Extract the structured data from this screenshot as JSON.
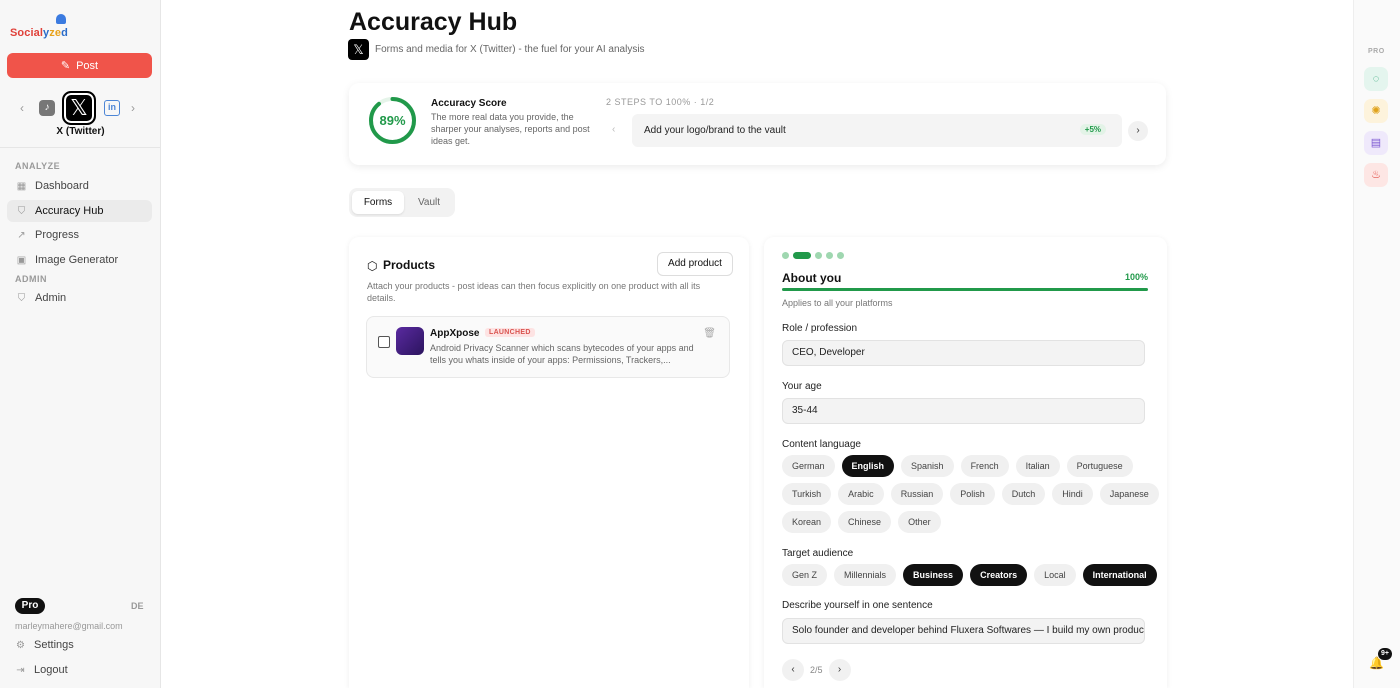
{
  "brand": {
    "part1": "Social",
    "part2": "y",
    "part3": "ze",
    "part4": "d"
  },
  "sidebar": {
    "post_label": "Post",
    "platform_label": "X (Twitter)",
    "section_analyze": "ANALYZE",
    "section_admin": "ADMIN",
    "items": [
      {
        "label": "Dashboard",
        "icon": "grid-icon"
      },
      {
        "label": "Accuracy Hub",
        "icon": "shield-icon"
      },
      {
        "label": "Progress",
        "icon": "trend-icon"
      },
      {
        "label": "Image Generator",
        "icon": "image-icon"
      }
    ],
    "admin_item": "Admin",
    "plan": "Pro",
    "lang": "DE",
    "email": "marleymahere@gmail.com",
    "settings": "Settings",
    "logout": "Logout"
  },
  "header": {
    "title": "Accuracy Hub",
    "subtitle": "Forms and media for X (Twitter) - the fuel for your AI analysis"
  },
  "score": {
    "value": "89%",
    "fraction": 0.89,
    "title": "Accuracy Score",
    "description": "The more real data you provide, the sharper your analyses, reports and post ideas get.",
    "steps_label": "2 STEPS TO 100% · 1/2",
    "step_text": "Add your logo/brand to the vault",
    "step_boost": "+5%"
  },
  "tabs": {
    "forms": "Forms",
    "vault": "Vault"
  },
  "products": {
    "title": "Products",
    "add_label": "Add product",
    "description": "Attach your products - post ideas can then focus explicitly on one product with all its details.",
    "items": [
      {
        "name": "AppXpose",
        "status": "LAUNCHED",
        "description": "Android Privacy Scanner which scans bytecodes of your apps and tells you whats inside of your apps: Permissions, Trackers,..."
      }
    ]
  },
  "about": {
    "title": "About you",
    "percent": "100%",
    "applies": "Applies to all your platforms",
    "role_label": "Role / profession",
    "role_value": "CEO, Developer",
    "age_label": "Your age",
    "age_value": "35-44",
    "language_label": "Content language",
    "languages": [
      "German",
      "English",
      "Spanish",
      "French",
      "Italian",
      "Portuguese",
      "Turkish",
      "Arabic",
      "Russian",
      "Polish",
      "Dutch",
      "Hindi",
      "Japanese",
      "Korean",
      "Chinese",
      "Other"
    ],
    "selected_language": "English",
    "audience_label": "Target audience",
    "audiences": [
      "Gen Z",
      "Millennials",
      "Business",
      "Creators",
      "Local",
      "International"
    ],
    "selected_audiences": [
      "Business",
      "Creators",
      "International"
    ],
    "sentence_label": "Describe yourself in one sentence",
    "sentence_value": "Solo founder and developer behind Fluxera Softwares — I build my own  products",
    "pager": "2/5"
  },
  "rail": {
    "pro": "PRO",
    "notifications": "9+"
  },
  "colors": {
    "accent": "#21994a",
    "post": "#f0544a"
  }
}
